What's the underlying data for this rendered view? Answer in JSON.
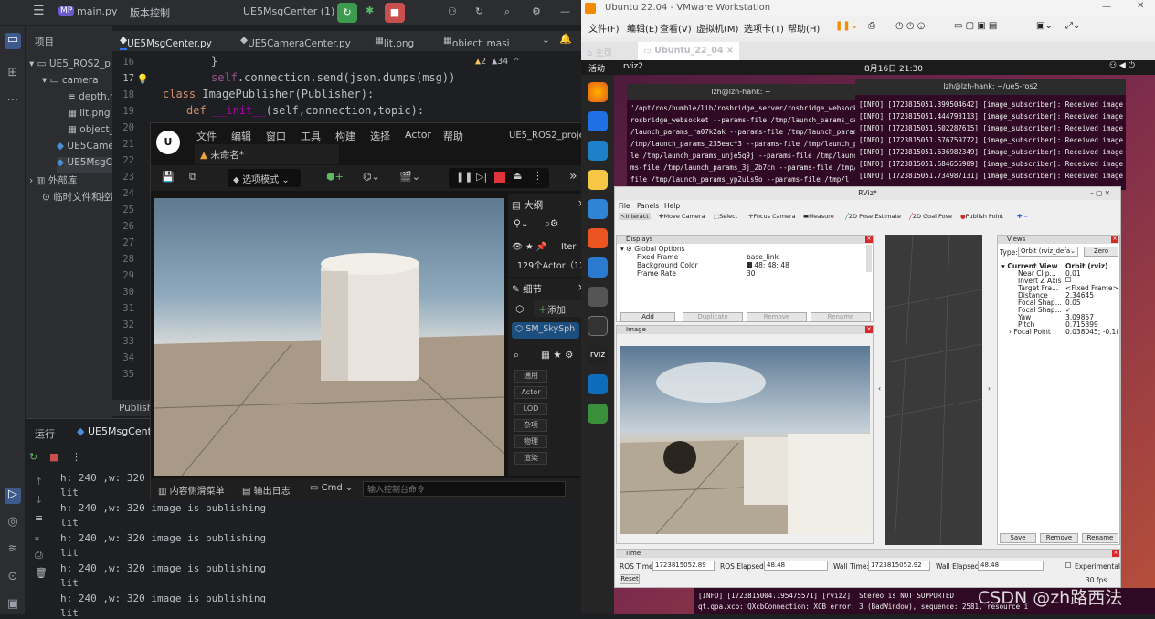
{
  "ide": {
    "project_initials": "MP",
    "file_title": "main.py",
    "vcs": "版本控制",
    "run_config": "UE5MsgCenter (1)",
    "side_title": "项目",
    "tree": [
      "UE5_ROS2_p",
      "camera",
      "depth.n",
      "lit.png",
      "object_",
      "UE5Came",
      "UE5MsgC",
      "外部库",
      "临时文件和控制"
    ],
    "tabs": [
      "UE5MsgCenter.py",
      "UE5CameraCenter.py",
      "lit.png",
      "object_masi"
    ],
    "warnings": "2",
    "weak": "34",
    "line_numbers": [
      "16",
      "17",
      "18",
      "19",
      "20",
      "21",
      "22",
      "23",
      "24",
      "25",
      "26",
      "27",
      "28",
      "29",
      "30",
      "31",
      "32",
      "33",
      "34",
      "35"
    ],
    "code": {
      "l16": "}",
      "l17a": "self",
      "l17b": ".connection.send(json.dumps(msg))",
      "l18a": "class",
      "l18b": " ImagePublisher(Publisher):",
      "l19a": "def",
      "l19b": "__init__",
      "l19c": "(self,connection,topic):"
    },
    "status": "Publish",
    "run_title": "运行",
    "run_tab": "UE5MsgCenter",
    "output": [
      "h: 240 ,w: 320 ir",
      "lit",
      "h: 240 ,w: 320 image is publishing",
      "lit",
      "h: 240 ,w: 320 image is publishing",
      "lit",
      "h: 240 ,w: 320 image is publishing",
      "lit",
      "h: 240 ,w: 320 image is publishing",
      "lit"
    ]
  },
  "ue": {
    "menu": [
      "文件",
      "编辑",
      "窗口",
      "工具",
      "构建",
      "选择",
      "Actor",
      "帮助"
    ],
    "project": "UE5_ROS2_project",
    "level": "未命名*",
    "mode": "选项模式",
    "outliner": "大纲",
    "actor_count": "129个Actor（12",
    "item_label": "Iter",
    "details": "细节",
    "add": "添加",
    "selected": "SM_SkySph",
    "categories": [
      "通用",
      "Actor",
      "LOD",
      "杂项",
      "物理",
      "渲染"
    ],
    "drawer": "内容侧滑菜单",
    "log": "输出日志",
    "cmd": "Cmd",
    "console_placeholder": "输入控制台命令"
  },
  "vm": {
    "title": "Ubuntu 22.04 - VMware Workstation",
    "menu": [
      "文件(F)",
      "编辑(E)",
      "查看(V)",
      "虚拟机(M)",
      "选项卡(T)",
      "帮助(H)"
    ],
    "tabs": [
      "主页",
      "Ubuntu_22_04"
    ],
    "gnome": {
      "activities": "活动",
      "app": "rviz2",
      "clock": "8月16日 21:30"
    },
    "term1": {
      "title": "lzh@lzh-hank: ~",
      "lines": [
        "'/opt/ros/humble/lib/rosbridge_server/rosbridge_websocke",
        "rosbridge_websocket --params-file /tmp/launch_params_cap",
        "/launch_params_ra07k2ak --params-file /tmp/launch_params",
        "/tmp/launch_params_235eac*3 --params-file /tmp/launch_pa",
        "le /tmp/launch_params_unje5q9j --params-file /tmp/launc",
        "ms-file /tmp/launch_params_3j_2b7cn --params-file /tmp/la",
        "file /tmp/launch_params_yp2uls9o --params-file /tmp/l"
      ]
    },
    "term2": {
      "title": "lzh@lzh-hank: ~/ue5-ros2",
      "lines": [
        "[INFO] [1723815051.399504642] [image_subscriber]: Received image",
        "[INFO] [1723815051.444793113] [image_subscriber]: Received image",
        "[INFO] [1723815051.502287615] [image_subscriber]: Received image",
        "[INFO] [1723815051.576759772] [image_subscriber]: Received image",
        "[INFO] [1723815051.636982349] [image_subscriber]: Received image",
        "[INFO] [1723815051.684656909] [image_subscriber]: Received image",
        "[INFO] [1723815051.734987131] [image_subscriber]: Received image"
      ]
    },
    "term3": {
      "lines": [
        "[INFO] [1723815004.195475571] [rviz2]: Stereo is NOT SUPPORTED",
        "qt.qpa.xcb: QXcbConnection: XCB error: 3 (BadWindow), sequence: 2581, resource i"
      ]
    }
  },
  "rviz": {
    "title": "RViz*",
    "menu": [
      "File",
      "Panels",
      "Help"
    ],
    "tools": [
      "Interact",
      "Move Camera",
      "Select",
      "Focus Camera",
      "Measure",
      "2D Pose Estimate",
      "2D Goal Pose",
      "Publish Point"
    ],
    "displays": "Displays",
    "global_options": "Global Options",
    "rows": [
      [
        "Fixed Frame",
        "base_link"
      ],
      [
        "Background Color",
        "48; 48; 48"
      ],
      [
        "Frame Rate",
        "30"
      ]
    ],
    "display_buttons": [
      "Add",
      "Duplicate",
      "Remove",
      "Rename"
    ],
    "image_panel": "Image",
    "views": "Views",
    "type_label": "Type:",
    "type_value": "Orbit (rviz_defa",
    "zero": "Zero",
    "view_rows": [
      [
        "Current View",
        "Orbit (rviz)"
      ],
      [
        "Near Clip...",
        "0.01"
      ],
      [
        "Invert Z Axis",
        ""
      ],
      [
        "Target Fra...",
        "<Fixed Frame>"
      ],
      [
        "Distance",
        "2.34645"
      ],
      [
        "Focal Shap...",
        "0.05"
      ],
      [
        "Focal Shap...",
        "✓"
      ],
      [
        "Yaw",
        "3.09857"
      ],
      [
        "Pitch",
        "0.715399"
      ],
      [
        "Focal Point",
        "0.038045; -0.182..."
      ]
    ],
    "view_buttons": [
      "Save",
      "Remove",
      "Rename"
    ],
    "time": "Time",
    "ros_time_label": "ROS Time:",
    "ros_time": "1723815052.89",
    "ros_elapsed_label": "ROS Elapsed:",
    "ros_elapsed": "48.48",
    "wall_time_label": "Wall Time:",
    "wall_time": "1723815052.92",
    "wall_elapsed_label": "Wall Elapsed:",
    "wall_elapsed": "48.48",
    "experimental": "Experimental",
    "reset": "Reset",
    "fps": "30 fps"
  },
  "watermark": "CSDN @zh路西法"
}
